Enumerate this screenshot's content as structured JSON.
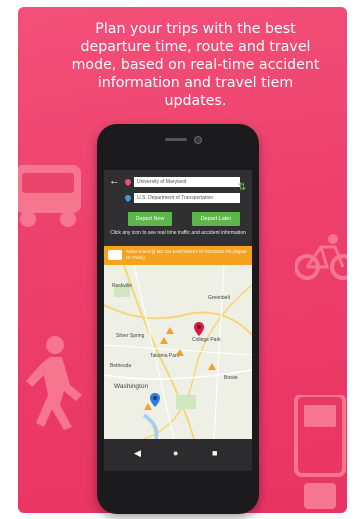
{
  "headline": "Plan your trips with the best departure time, route and travel mode, based on real-time accident information and travel tiem updates.",
  "route": {
    "from": "University of Maryland",
    "to": "U.S. Department of Transportation",
    "back_icon": "back-arrow-icon",
    "swap_icon": "swap-icon"
  },
  "buttons": {
    "depart_now": "Depart Now",
    "depart_later": "Depart Later"
  },
  "hint": "Click any icon to see real time traffic and accident information",
  "alert": {
    "text": "Active Event @ MD 214 EAST/WEST AT ADDISON RD (Signal On Flash)"
  },
  "map": {
    "labels": [
      "Silver Spring",
      "College Park",
      "Washington",
      "Greenbelt",
      "Takoma Park",
      "Rockville",
      "Bethesda",
      "Bowie"
    ]
  },
  "colors": {
    "background": "#ee3f6c",
    "accent_green": "#5cb648",
    "alert_orange": "#f5a21f",
    "pin_red": "#d81b45",
    "pin_blue": "#2f7dd8"
  }
}
